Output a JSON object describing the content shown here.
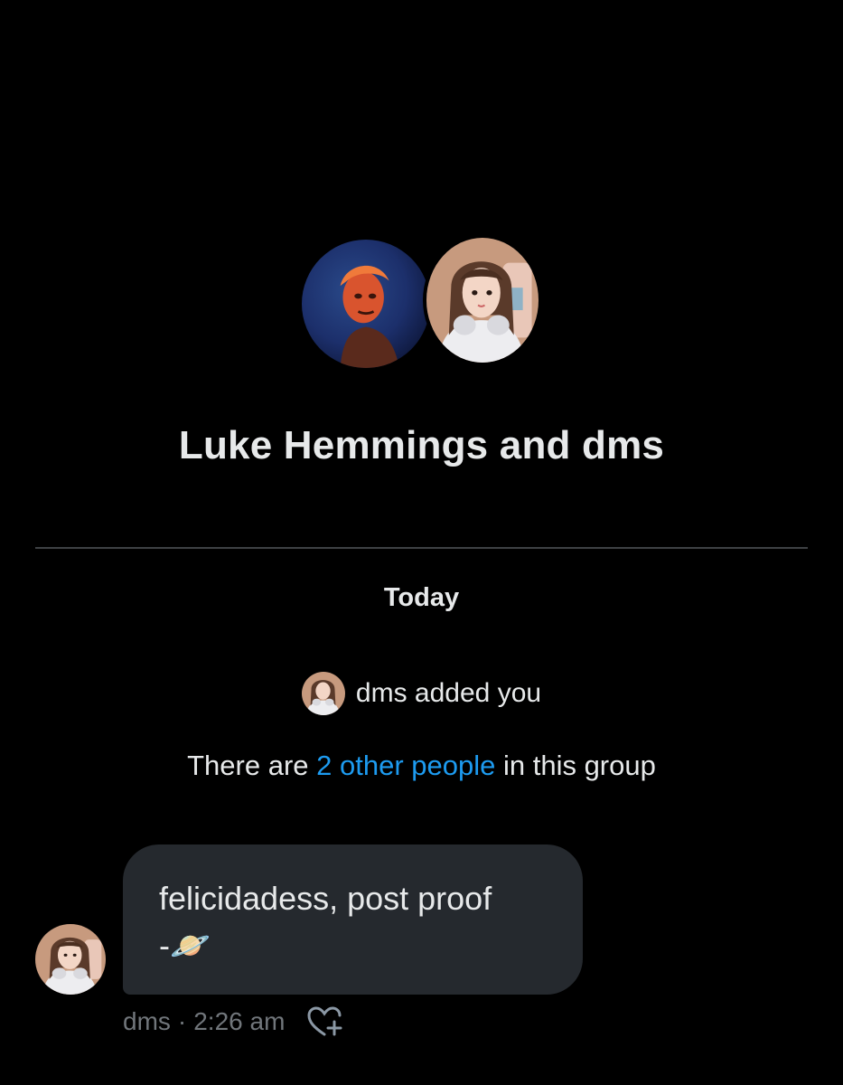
{
  "conversation": {
    "title": "Luke Hemmings and dms",
    "participants": [
      {
        "name": "Luke Hemmings",
        "avatar": "luke-avatar"
      },
      {
        "name": "dms",
        "avatar": "dms-avatar"
      }
    ]
  },
  "timeline": {
    "date_label": "Today",
    "added_event": "dms added you",
    "group_info_prefix": "There are ",
    "group_info_link": "2 other people",
    "group_info_suffix": " in this group"
  },
  "message": {
    "line1": "felicidadess, post proof",
    "line2": "-🪐",
    "sender": "dms",
    "separator": "·",
    "time": "2:26 am",
    "react_icon": "heart-plus-icon"
  },
  "colors": {
    "background": "#000000",
    "text": "#e7e9ea",
    "link": "#1d9bf0",
    "muted": "#71767b",
    "bubble": "#25292e",
    "divider": "#3e4144"
  }
}
